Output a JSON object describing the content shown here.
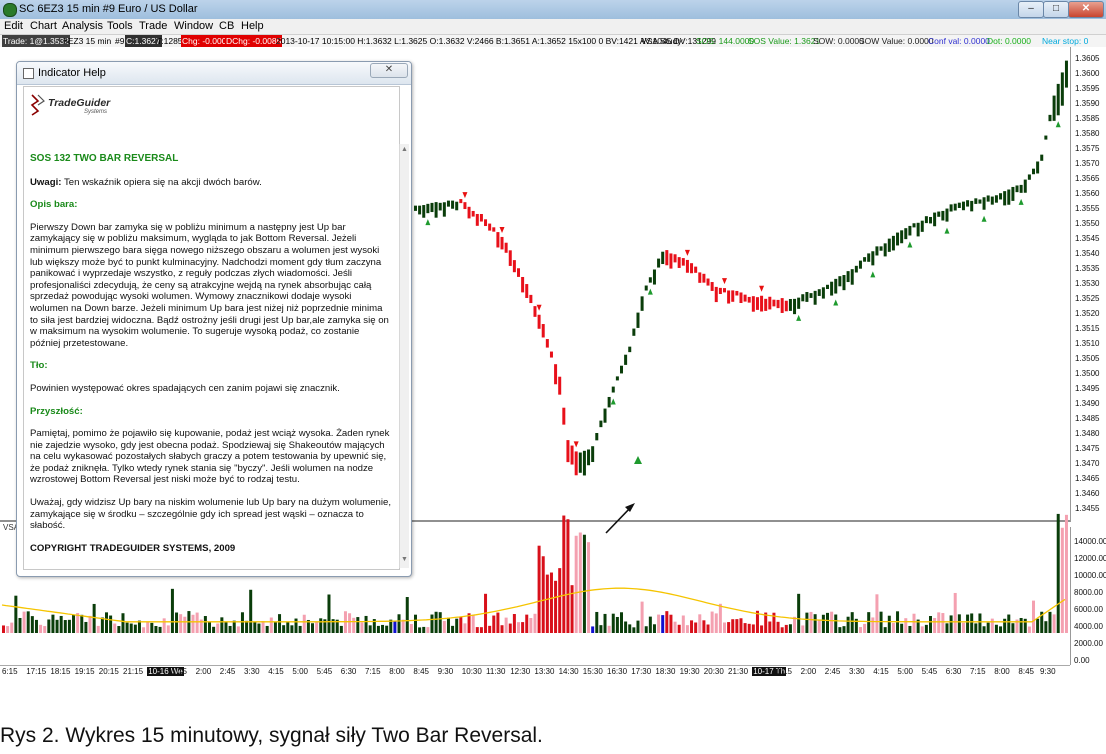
{
  "window": {
    "title": "SC 6EZ3  15 min  #9  Euro / US Dollar",
    "controls": {
      "minimize": "–",
      "maximize": "□",
      "close": "✕"
    }
  },
  "menu": {
    "items": [
      "Edit",
      "Chart",
      "Analysis",
      "Tools",
      "Trade",
      "Window",
      "CB",
      "Help"
    ]
  },
  "infobar": {
    "trade": "Trade: 1@1.3532",
    "symbol": "6EZ3  15 min",
    "bar": "#9",
    "close": "C:1.3627",
    "ticks": "T:1285",
    "chg": "Chg: -0.0004",
    "dchg": "DChg: -0.0085",
    "ohlc": "2013-10-17 10:15:00 H:1.3632 L:1.3625 O:1.3632 V:2466 B:1.3651 A:1.3652 15x100 0 BV:1421 AV:1045 DV:131299",
    "vsa_label": "VSA Study:",
    "sos": "SOS: 144.0000",
    "sos_value": "SOS Value: 1.3621",
    "sow": "SOW: 0.0000",
    "sow_value": "SOW Value: 0.0000",
    "conf": "Conf val: 0.0000",
    "dot": "Dot: 0.0000",
    "near_stop": "Near stop: 0"
  },
  "vol_pane_label": "VSA",
  "price_axis": [
    "1.3605",
    "1.3600",
    "1.3595",
    "1.3590",
    "1.3585",
    "1.3580",
    "1.3575",
    "1.3570",
    "1.3565",
    "1.3560",
    "1.3555",
    "1.3550",
    "1.3545",
    "1.3540",
    "1.3535",
    "1.3530",
    "1.3525",
    "1.3520",
    "1.3515",
    "1.3510",
    "1.3505",
    "1.3500",
    "1.3495",
    "1.3490",
    "1.3485",
    "1.3480",
    "1.3475",
    "1.3470",
    "1.3465",
    "1.3460",
    "1.3455"
  ],
  "vol_axis": [
    "14000.00",
    "12000.00",
    "10000.00",
    "8000.00",
    "6000.00",
    "4000.00",
    "2000.00",
    "0.00"
  ],
  "time_axis": [
    "6:15",
    "17:15",
    "18:15",
    "19:15",
    "20:15",
    "21:15",
    "10-16 We",
    "1:15",
    "2:00",
    "2:45",
    "3:30",
    "4:15",
    "5:00",
    "5:45",
    "6:30",
    "7:15",
    "8:00",
    "8:45",
    "9:30",
    "10:30",
    "11:30",
    "12:30",
    "13:30",
    "14:30",
    "15:30",
    "16:30",
    "17:30",
    "18:30",
    "19:30",
    "20:30",
    "21:30",
    "10-17 Th",
    "1:15",
    "2:00",
    "2:45",
    "3:30",
    "4:15",
    "5:00",
    "5:45",
    "6:30",
    "7:15",
    "8:00",
    "8:45",
    "9:30"
  ],
  "colors": {
    "up_bar": "#0a3d0a",
    "down_bar": "#e8101a",
    "vol_up": "#0a3d0a",
    "vol_down": "#d8101a",
    "vol_light": "#f4a0b0",
    "vol_blue": "#1010d0",
    "vol_avg": "#f5c400",
    "sos_marker": "#1e9a2e",
    "sow_marker": "#e81010",
    "help_heading": "#1a8a1a"
  },
  "chart_data": {
    "type": "candlestick",
    "price_range": [
      1.3452,
      1.3612
    ],
    "volume_range": [
      0,
      15000
    ],
    "annotation": "arrow pointing to Two Bar Reversal SOS signal near 1.3477"
  },
  "help": {
    "title": "Indicator Help",
    "close_label": "✕",
    "logo": "TradeGuider",
    "logo_sub": "Systems",
    "heading": "SOS 132 TWO BAR REVERSAL",
    "note_label": "Uwagi:",
    "note_text": "Ten wskaźnik opiera się na akcji dwóch barów.",
    "bar_desc_heading": "Opis bara:",
    "bar_desc": "Pierwszy Down bar zamyka się w pobliżu minimum a następny jest Up bar zamykający się w pobliżu maksimum, wygląda to jak Bottom Reversal. Jeżeli minimum pierwszego bara sięga nowego niższego obszaru a wolumen jest wysoki lub większy może być to punkt kulminacyjny. Nadchodzi moment gdy tłum zaczyna panikować i wyprzedaje wszystko, z reguły podczas złych wiadomości. Jeśli profesjonaliści zdecydują, że ceny są atrakcyjne wejdą na rynek absorbując całą sprzedaż powodując wysoki wolumen. Wymowy znacznikowi dodaje wysoki wolumen na Down barze. Jeżeli minimum Up bara jest niżej niż poprzednie minima to siła jest bardziej widoczna. Bądź ostrożny jeśli drugi jest Up bar,ale zamyka się on w maksimum na wysokim wolumenie. To sugeruje wysoką podaż, co zostanie później przetestowane.",
    "background_heading": "Tło:",
    "background": "Powinien występować okres spadających cen zanim pojawi się znacznik.",
    "future_heading": "Przyszłość:",
    "future": "Pamiętaj, pomimo że pojawiło się kupowanie, podaż jest wciąż wysoka. Żaden rynek nie zajedzie wysoko, gdy jest obecna podaż. Spodziewaj się Shakeoutów mających na celu wykasować pozostałych słabych graczy a potem testowania by upewnić się, że podaż zniknęła. Tylko wtedy rynek stania się \"byczy\". Jeśli wolumen na nodze wzrostowej Bottom Reversal jest niski może być to rodzaj testu.",
    "warning": "Uważaj, gdy widzisz Up bary na niskim wolumenie lub Up bary na dużym wolumenie, zamykające się w środku – szczególnie gdy ich spread jest wąski – oznacza to słabość.",
    "copyright": "COPYRIGHT TRADEGUIDER SYSTEMS, 2009"
  },
  "caption": "Rys 2. Wykres 15 minutowy, sygnał siły Two Bar Reversal."
}
